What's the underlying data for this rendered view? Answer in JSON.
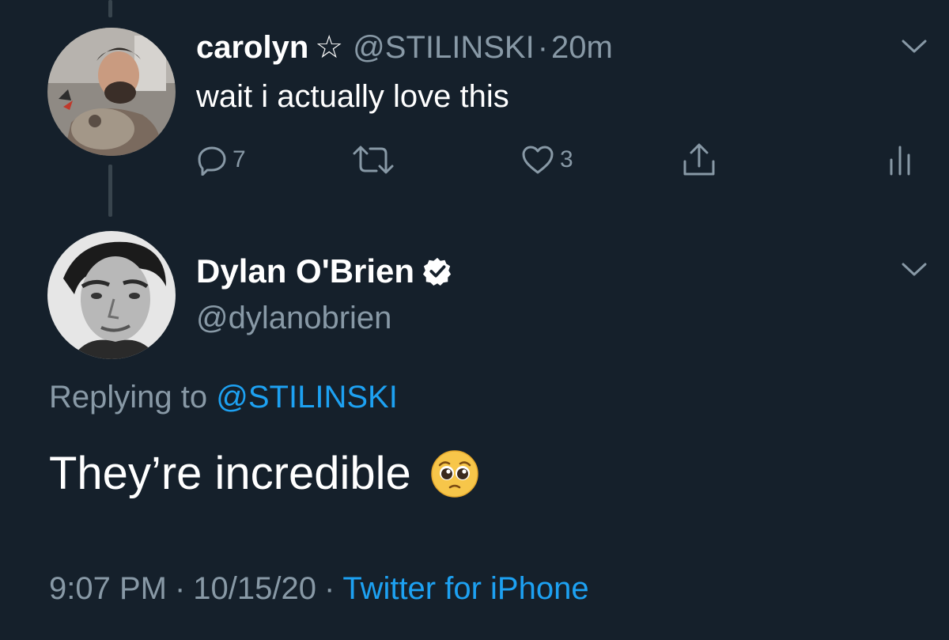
{
  "reply_to_tweet": {
    "display_name": "carolyn",
    "name_badge": "☆",
    "handle": "@STILINSKI",
    "separator": "·",
    "time": "20m",
    "text": "wait i actually love this",
    "actions": {
      "reply_count": "7",
      "retweet_count": "",
      "like_count": "3"
    },
    "icons": [
      "reply-icon",
      "retweet-icon",
      "like-icon",
      "share-icon",
      "analytics-icon",
      "chevron-down-icon"
    ]
  },
  "main_tweet": {
    "display_name": "Dylan O'Brien",
    "verified": true,
    "handle": "@dylanobrien",
    "replying_prefix": "Replying to",
    "replying_handle": "@STILINSKI",
    "text": "They’re incredible",
    "emoji": "pleading-face-emoji",
    "time": "9:07 PM",
    "date": "10/15/20",
    "separator": "·",
    "source": "Twitter for iPhone"
  },
  "colors": {
    "background": "#15202b",
    "primary_text": "#ffffff",
    "secondary_text": "#8899a6",
    "accent": "#1da1f2",
    "thread_line": "#38444d"
  }
}
